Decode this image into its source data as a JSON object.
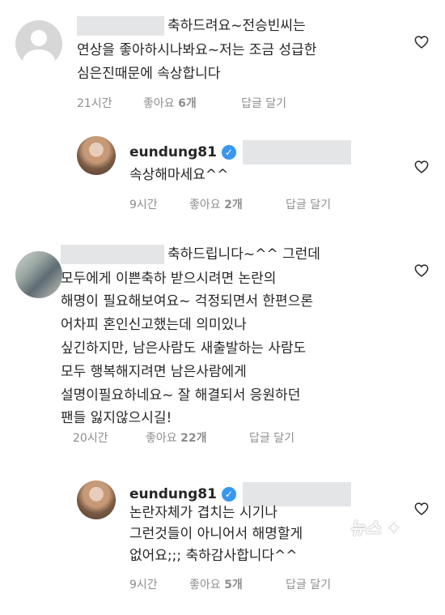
{
  "comments": [
    {
      "lines": [
        "축하드려요~전승빈씨는",
        "연상을 좋아하시나봐요~저는 조금 성급한",
        "심은진때문에 속상합니다"
      ],
      "time": "21시간",
      "likes_label": "좋아요",
      "likes_count": "6개",
      "reply": "답글 달기",
      "heart_icon": "heart-outline-icon"
    },
    {
      "username": "eundung81",
      "lines": [
        "속상해마세요^^"
      ],
      "time": "9시간",
      "likes_label": "좋아요",
      "likes_count": "2개",
      "reply": "답글 달기",
      "heart_icon": "heart-outline-icon"
    },
    {
      "lines": [
        "축하드립니다~^^ 그런데",
        "모두에게 이쁜축하 받으시려면 논란의",
        "해명이 필요해보여요~ 걱정되면서 한편으론",
        "어차피 혼인신고했는데 의미있나",
        "싶긴하지만, 남은사람도 새출발하는 사람도",
        "모두 행복해지려면 남은사람에게",
        "설명이필요하네요~ 잘 해결되서 응원하던",
        "팬들 잃지않으시길!"
      ],
      "time": "20시간",
      "likes_label": "좋아요",
      "likes_count": "22개",
      "reply": "답글 달기",
      "heart_icon": "heart-outline-icon"
    },
    {
      "username": "eundung81",
      "lines": [
        "논란자체가 겹치는 시기나",
        "그런것들이 아니어서 해명할게",
        "없어요;;; 축하감사합니다^^"
      ],
      "time": "9시간",
      "likes_label": "좋아요",
      "likes_count": "5개",
      "reply": "답글 달기",
      "heart_icon": "heart-outline-icon"
    }
  ],
  "watermark": "뉴스",
  "colors": {
    "text": "#262626",
    "meta": "#8e8e8e",
    "verified": "#3897f0",
    "blur": "#e3e5e7"
  }
}
